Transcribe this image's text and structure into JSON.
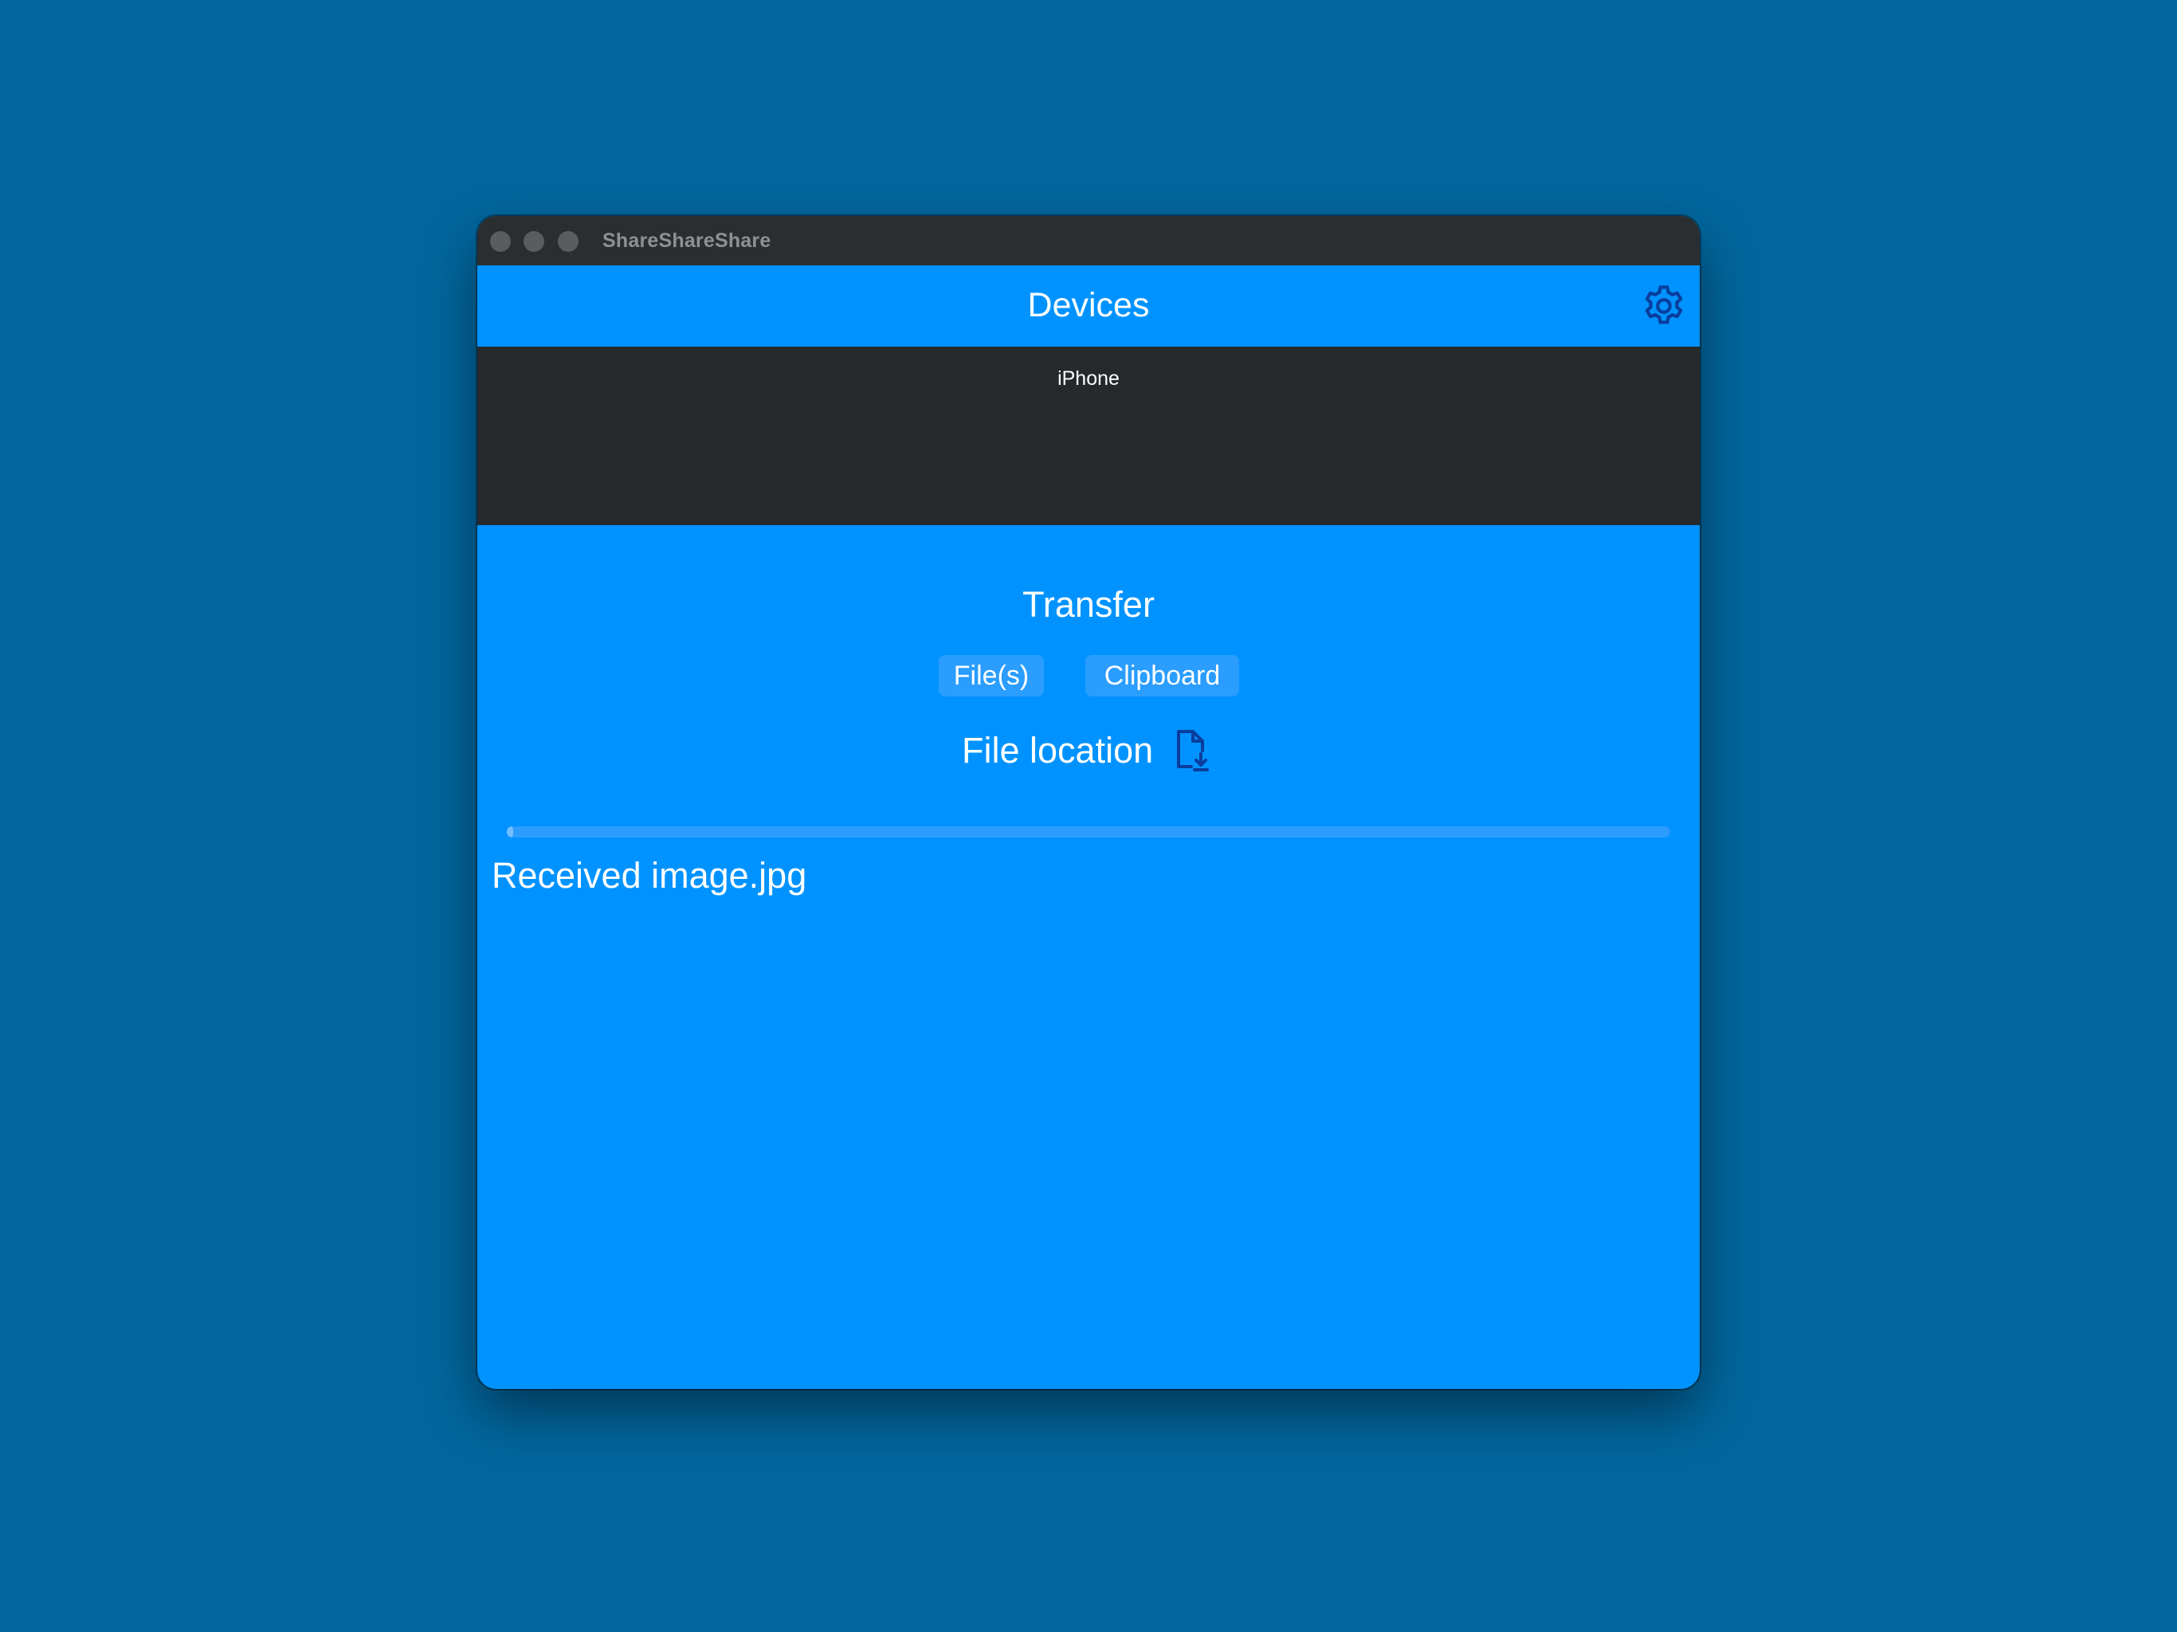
{
  "window": {
    "title": "ShareShareShare"
  },
  "header": {
    "title": "Devices",
    "settings_icon": "gear-icon"
  },
  "devices": {
    "items": [
      {
        "label": "iPhone"
      }
    ]
  },
  "transfer": {
    "title": "Transfer",
    "files_button": "File(s)",
    "clipboard_button": "Clipboard",
    "file_location_label": "File location",
    "file_location_icon": "file-download-icon"
  },
  "progress": {
    "value": 0.005
  },
  "status": {
    "text": "Received image.jpg"
  },
  "colors": {
    "desktop": "#02679f",
    "accent": "#0093ff",
    "device_list_bg": "#25292c",
    "icon": "#0a3d9c"
  }
}
